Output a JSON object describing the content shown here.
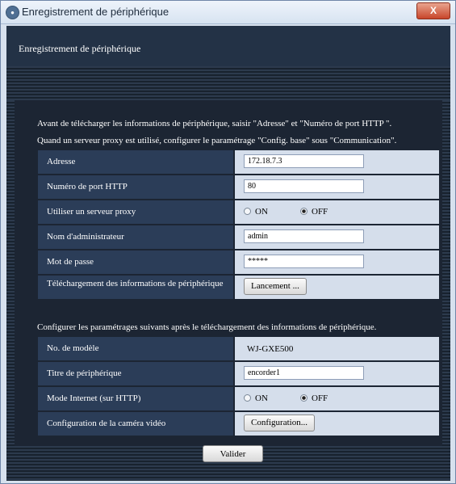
{
  "window": {
    "title": "Enregistrement de périphérique",
    "app_icon": "camera-app-icon",
    "close_label": "X"
  },
  "header": {
    "title": "Enregistrement de périphérique"
  },
  "intro": {
    "line1": "Avant de télécharger les informations de périphérique, saisir \"Adresse\" et \"Numéro de port HTTP \".",
    "line2": "Quand un serveur proxy est utilisé, configurer le paramétrage \"Config. base\" sous \"Communication\"."
  },
  "section1": {
    "address": {
      "label": "Adresse",
      "value": "172.18.7.3"
    },
    "http_port": {
      "label": "Numéro de port HTTP",
      "value": "80"
    },
    "proxy": {
      "label": "Utiliser un serveur proxy",
      "on_label": "ON",
      "off_label": "OFF",
      "selected": "OFF"
    },
    "admin_name": {
      "label": "Nom d'administrateur",
      "value": "admin"
    },
    "password": {
      "label": "Mot de passe",
      "value": "*****"
    },
    "download": {
      "label": "Téléchargement des informations de périphérique",
      "button_label": "Lancement ..."
    }
  },
  "section2": {
    "intro": "Configurer les paramétrages suivants après le téléchargement des informations de périphérique.",
    "model": {
      "label": "No. de modèle",
      "value": "WJ-GXE500"
    },
    "device_title": {
      "label": "Titre de périphérique",
      "value": "encorder1"
    },
    "internet_mode": {
      "label": "Mode Internet (sur HTTP)",
      "on_label": "ON",
      "off_label": "OFF",
      "selected": "OFF"
    },
    "camera_config": {
      "label": "Configuration de la caméra vidéo",
      "button_label": "Configuration..."
    }
  },
  "footer": {
    "submit_label": "Valider"
  }
}
